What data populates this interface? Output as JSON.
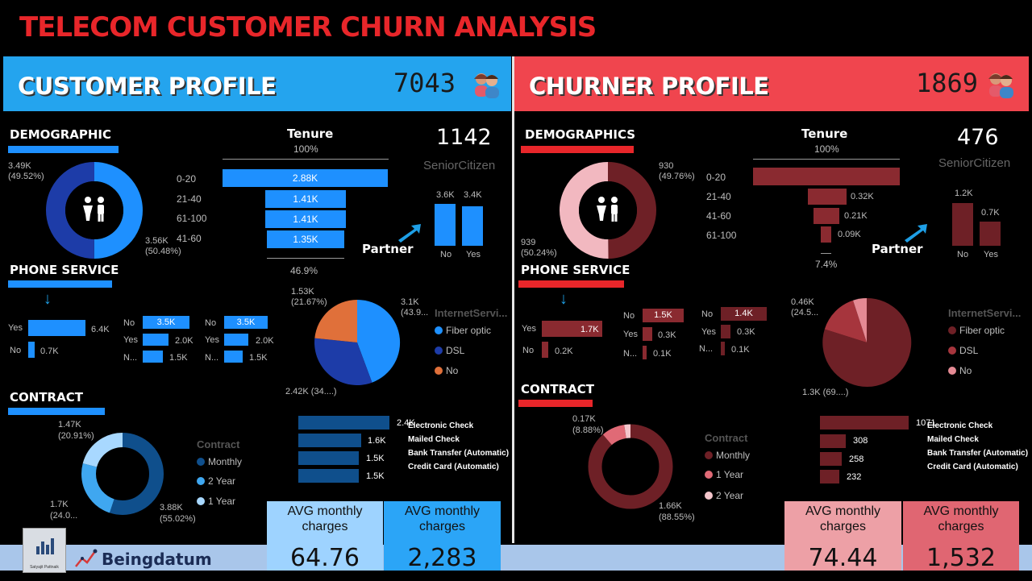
{
  "title": "TELECOM CUSTOMER CHURN ANALYSIS",
  "colors": {
    "blue_banner": "#24a4ee",
    "red_banner": "#f0454e",
    "blue_bar": "#1e90ff",
    "dark_red": "#6e2026",
    "title_red": "#e8262a"
  },
  "customer": {
    "banner_title": "CUSTOMER PROFILE",
    "count": "7043",
    "demographic": {
      "heading": "DEMOGRAPHIC",
      "donut_top": "3.49K",
      "donut_top_pct": "(49.52%)",
      "donut_bottom": "3.56K",
      "donut_bottom_pct": "(50.48%)"
    },
    "tenure": {
      "heading": "Tenure",
      "top_pct": "100%",
      "bottom_pct": "46.9%",
      "rows": [
        {
          "label": "0-20",
          "value": "2.88K"
        },
        {
          "label": "21-40",
          "value": "1.41K"
        },
        {
          "label": "61-100",
          "value": "1.41K"
        },
        {
          "label": "41-60",
          "value": "1.35K"
        }
      ]
    },
    "senior": {
      "value": "1142",
      "label": "SeniorCitizen"
    },
    "partner": {
      "label": "Partner",
      "bars": [
        {
          "label": "No",
          "value": "3.6K"
        },
        {
          "label": "Yes",
          "value": "3.4K"
        }
      ]
    },
    "phone": {
      "heading": "PHONE SERVICE",
      "main": [
        {
          "label": "Yes",
          "value": "6.4K"
        },
        {
          "label": "No",
          "value": "0.7K"
        }
      ],
      "g2": [
        {
          "label": "No",
          "value": "3.5K"
        },
        {
          "label": "Yes",
          "value": "2.0K"
        },
        {
          "label": "N...",
          "value": "1.5K"
        }
      ],
      "g3": [
        {
          "label": "No",
          "value": "3.5K"
        },
        {
          "label": "Yes",
          "value": "2.0K"
        },
        {
          "label": "N...",
          "value": "1.5K"
        }
      ]
    },
    "internet": {
      "label_top_left": "1.53K",
      "label_top_left_pct": "(21.67%)",
      "label_right": "3.1K",
      "label_right_pct": "(43.9...",
      "label_bottom": "2.42K (34....)",
      "legend_title": "InternetServi...",
      "legend": [
        "Fiber optic",
        "DSL",
        "No"
      ]
    },
    "contract": {
      "heading": "CONTRACT",
      "label_top": "1.47K",
      "label_top_pct": "(20.91%)",
      "label_left": "1.7K",
      "label_left_pct": "(24.0...",
      "label_right": "3.88K",
      "label_right_pct": "(55.02%)",
      "legend_title": "Contract",
      "legend": [
        "Monthly",
        "2 Year",
        "1 Year"
      ]
    },
    "payment": {
      "rows": [
        {
          "label": "Electronic Check",
          "value": "2.4K"
        },
        {
          "label": "Mailed Check",
          "value": "1.6K"
        },
        {
          "label": "Bank Transfer (Automatic)",
          "value": "1.5K"
        },
        {
          "label": "Credit Card (Automatic)",
          "value": "1.5K"
        }
      ]
    },
    "avg1": {
      "caption": "AVG monthly charges",
      "value": "64.76"
    },
    "avg2": {
      "caption": "AVG monthly charges",
      "value": "2,283"
    }
  },
  "churner": {
    "banner_title": "CHURNER PROFILE",
    "count": "1869",
    "demographic": {
      "heading": "DEMOGRAPHICS",
      "donut_top": "930",
      "donut_top_pct": "(49.76%)",
      "donut_bottom": "939",
      "donut_bottom_pct": "(50.24%)"
    },
    "tenure": {
      "heading": "Tenure",
      "top_pct": "100%",
      "bottom_pct": "7.4%",
      "rows": [
        {
          "label": "0-20",
          "value": ""
        },
        {
          "label": "21-40",
          "value": "0.32K"
        },
        {
          "label": "41-60",
          "value": "0.21K"
        },
        {
          "label": "61-100",
          "value": "0.09K"
        }
      ]
    },
    "senior": {
      "value": "476",
      "label": "SeniorCitizen"
    },
    "partner": {
      "label": "Partner",
      "bars": [
        {
          "label": "No",
          "value": "1.2K"
        },
        {
          "label": "Yes",
          "value": "0.7K"
        }
      ]
    },
    "phone": {
      "heading": "PHONE SERVICE",
      "main": [
        {
          "label": "Yes",
          "value": "1.7K"
        },
        {
          "label": "No",
          "value": "0.2K"
        }
      ],
      "g2": [
        {
          "label": "No",
          "value": "1.5K"
        },
        {
          "label": "Yes",
          "value": "0.3K"
        },
        {
          "label": "N...",
          "value": "0.1K"
        }
      ],
      "g3": [
        {
          "label": "No",
          "value": "1.4K"
        },
        {
          "label": "Yes",
          "value": "0.3K"
        },
        {
          "label": "N...",
          "value": "0.1K"
        }
      ]
    },
    "internet": {
      "label_top_left": "0.46K",
      "label_top_left_pct": "(24.5...",
      "label_bottom": "1.3K (69....)",
      "legend_title": "InternetServi...",
      "legend": [
        "Fiber optic",
        "DSL",
        "No"
      ]
    },
    "contract": {
      "heading": "CONTRACT",
      "label_top": "0.17K",
      "label_top_pct": "(8.88%)",
      "label_right": "1.66K",
      "label_right_pct": "(88.55%)",
      "legend_title": "Contract",
      "legend": [
        "Monthly",
        "1 Year",
        "2 Year"
      ]
    },
    "payment": {
      "rows": [
        {
          "label": "Electronic Check",
          "value": "1071"
        },
        {
          "label": "Mailed Check",
          "value": "308"
        },
        {
          "label": "Bank Transfer (Automatic)",
          "value": "258"
        },
        {
          "label": "Credit Card (Automatic)",
          "value": "232"
        }
      ]
    },
    "avg1": {
      "caption": "AVG monthly charges",
      "value": "74.44"
    },
    "avg2": {
      "caption": "AVG monthly charges",
      "value": "1,532"
    }
  },
  "footer": {
    "brand": "Beingdatum",
    "logo_text": "Satyajit Pattnaik"
  }
}
